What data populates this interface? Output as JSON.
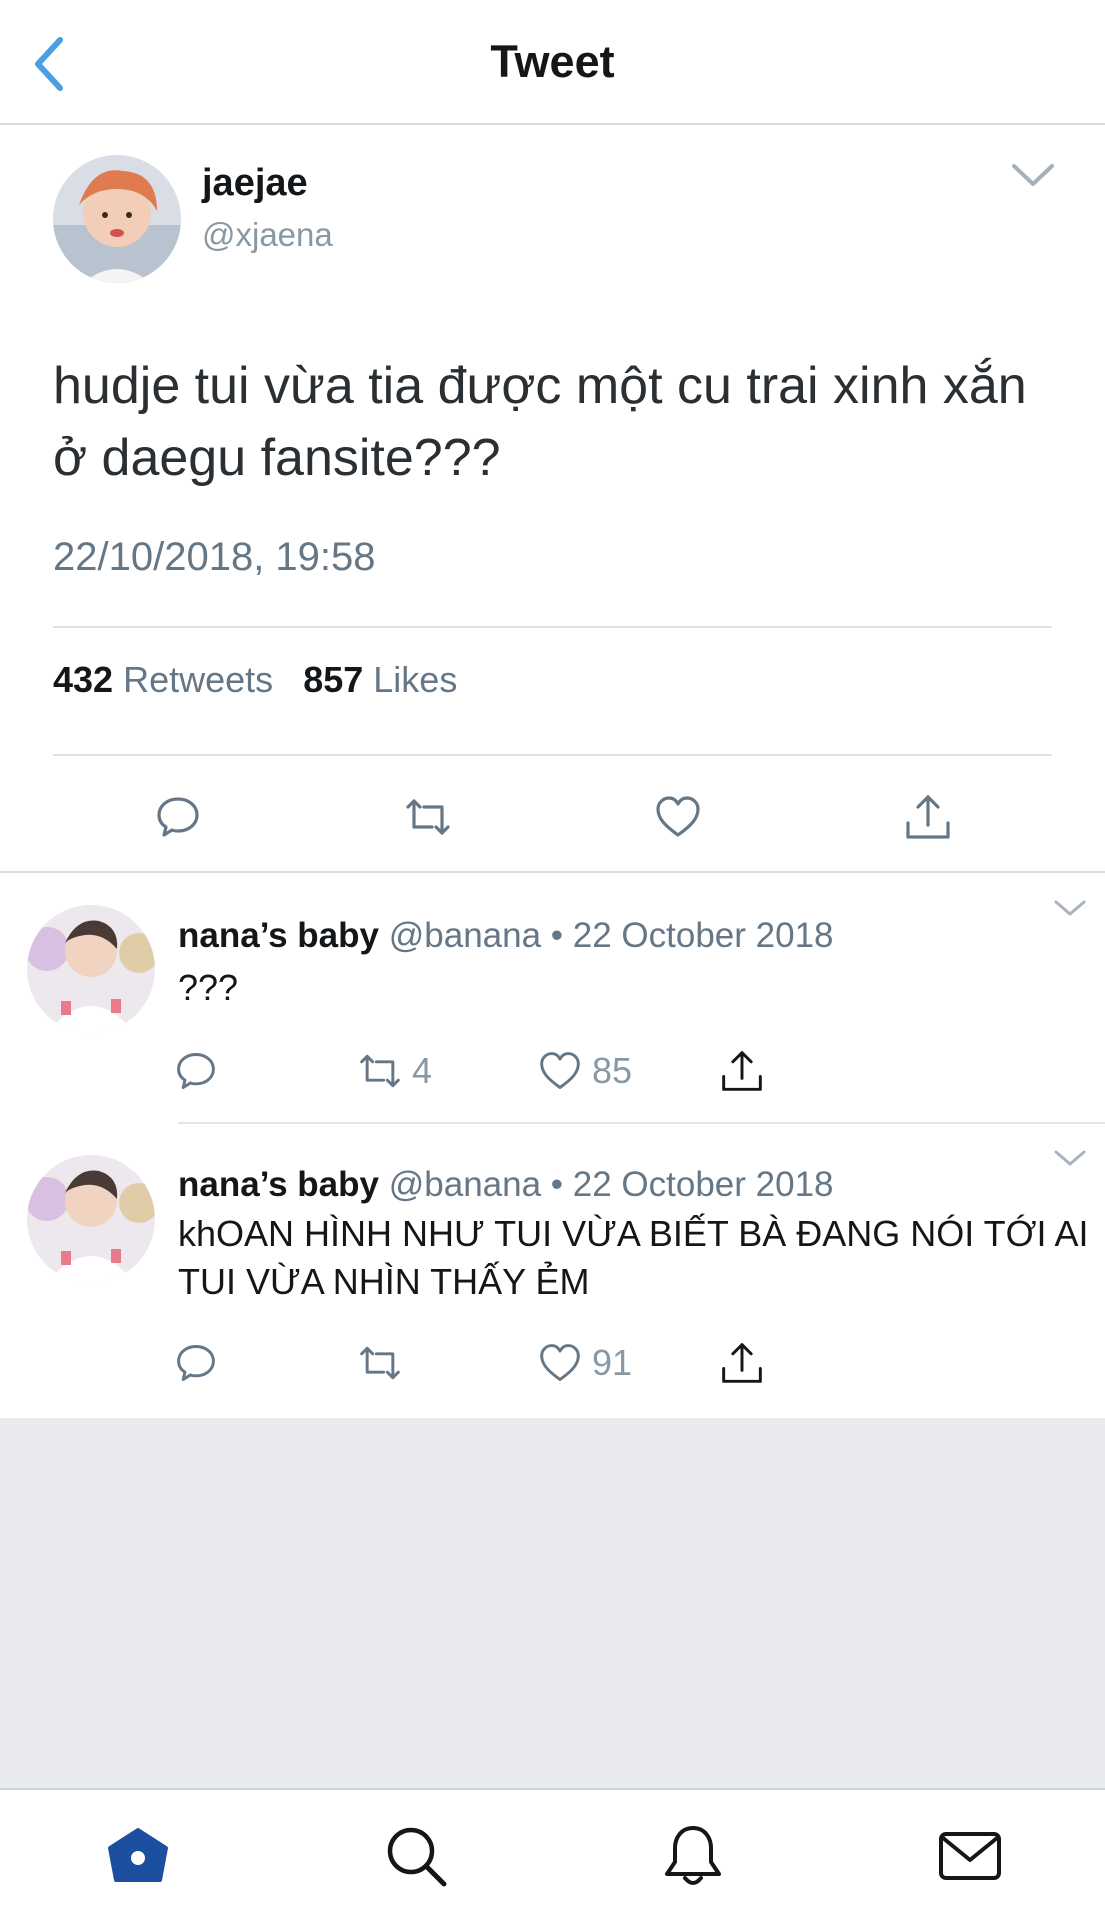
{
  "header": {
    "title": "Tweet",
    "back_icon": "chevron-left-icon"
  },
  "main_tweet": {
    "name": "jaejae",
    "handle": "@xjaena",
    "text": "hudje tui vừa tia được một cu trai xinh xắn ở daegu fansite???",
    "timestamp": "22/10/2018, 19:58",
    "retweets_count": "432",
    "retweets_label": "Retweets",
    "likes_count": "857",
    "likes_label": "Likes",
    "actions": [
      "reply-icon",
      "retweet-icon",
      "like-icon",
      "share-icon"
    ]
  },
  "replies": [
    {
      "name": "nana’s baby",
      "handle_date": "@banana • 22 October 2018",
      "text": "???",
      "retweets": "4",
      "likes": "85"
    },
    {
      "name": "nana’s baby",
      "handle_date": "@banana • 22 October 2018",
      "text": "khOAN HÌNH NHƯ TUI VỪA BIẾT BÀ ĐANG NÓI TỚI AI TUI VỪA NHÌN THẤY ẺM",
      "retweets": "",
      "likes": "91"
    }
  ],
  "tabbar": {
    "items": [
      "home-icon",
      "search-icon",
      "notifications-icon",
      "messages-icon"
    ],
    "active_color": "#1d4fa0"
  },
  "colors": {
    "accent": "#1da1f2",
    "muted": "#657786"
  }
}
